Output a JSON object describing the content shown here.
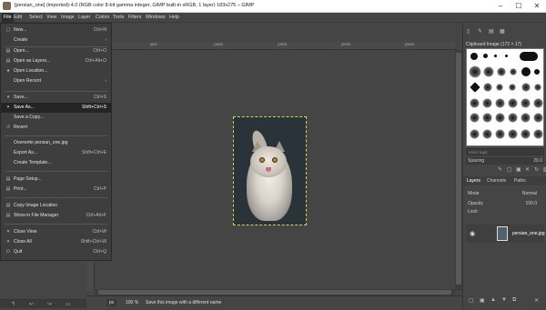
{
  "window": {
    "title": "[persian_one] (imported)-4.0 (RGB color 8-bit gamma integer, GIMP built-in sRGB, 1 layer) 183x275 – GIMP",
    "min": "–",
    "max": "☐",
    "close": "✕"
  },
  "menubar": [
    "File",
    "Edit",
    "Select",
    "View",
    "Image",
    "Layer",
    "Colors",
    "Tools",
    "Filters",
    "Windows",
    "Help"
  ],
  "file_menu": {
    "items": [
      {
        "label": "New...",
        "shortcut": "Ctrl+N",
        "icon": "▢"
      },
      {
        "label": "Create",
        "shortcut": "›",
        "icon": ""
      },
      {
        "label": "Open...",
        "shortcut": "Ctrl+O",
        "icon": "▤"
      },
      {
        "label": "Open as Layers...",
        "shortcut": "Ctrl+Alt+O",
        "icon": "▤"
      },
      {
        "label": "Open Location...",
        "shortcut": "",
        "icon": "●"
      },
      {
        "label": "Open Recent",
        "shortcut": "›",
        "icon": ""
      },
      {
        "label": "Save...",
        "shortcut": "Ctrl+S",
        "icon": "▾"
      },
      {
        "label": "Save As...",
        "shortcut": "Shift+Ctrl+S",
        "icon": "▾"
      },
      {
        "label": "Save a Copy...",
        "shortcut": "",
        "icon": ""
      },
      {
        "label": "Revert",
        "shortcut": "",
        "icon": "↺"
      },
      {
        "label": "Overwrite persian_one.jpg",
        "shortcut": "",
        "icon": ""
      },
      {
        "label": "Export As...",
        "shortcut": "Shift+Ctrl+E",
        "icon": ""
      },
      {
        "label": "Create Template...",
        "shortcut": "",
        "icon": ""
      },
      {
        "label": "Page Setup...",
        "shortcut": "",
        "icon": "▤"
      },
      {
        "label": "Print...",
        "shortcut": "Ctrl+P",
        "icon": "▤"
      },
      {
        "label": "Copy Image Location",
        "shortcut": "",
        "icon": "▤"
      },
      {
        "label": "Show in File Manager",
        "shortcut": "Ctrl+Alt+F",
        "icon": "▤"
      },
      {
        "label": "Close View",
        "shortcut": "Ctrl+W",
        "icon": "✕"
      },
      {
        "label": "Close All",
        "shortcut": "Shift+Ctrl+W",
        "icon": "✕"
      },
      {
        "label": "Quit",
        "shortcut": "Ctrl+Q",
        "icon": "⏻"
      }
    ]
  },
  "left_buttons": [
    "↰",
    "↩",
    "↪",
    "▭"
  ],
  "ruler_ticks": [
    "0",
    "|500",
    "|1000",
    "|1500",
    "|2000",
    "|2500"
  ],
  "statusbar": {
    "unit": "px",
    "zoom": "100 %",
    "message": "Save this image with a different name"
  },
  "right_panel": {
    "top_buttons": [
      "▯",
      "✎",
      "▤",
      "▦"
    ],
    "brush_title": "Clipboard Image (172 × 17)",
    "tag_placeholder": "enter tags",
    "spacing_label": "Spacing",
    "spacing_value": "20.0",
    "brush_buttons": [
      "✎",
      "▢",
      "▣",
      "✕",
      "↻",
      "▨"
    ],
    "tabs": [
      "Layers",
      "Channels",
      "Paths"
    ],
    "mode_label": "Mode",
    "mode_value": "Normal",
    "opacity_label": "Opacity",
    "opacity_value": "100.0",
    "lock_label": "Lock:",
    "layer_name": "persian_one.jpg",
    "layer_buttons": [
      "▢",
      "▣",
      "▲",
      "▼",
      "⧉",
      "✕"
    ]
  }
}
